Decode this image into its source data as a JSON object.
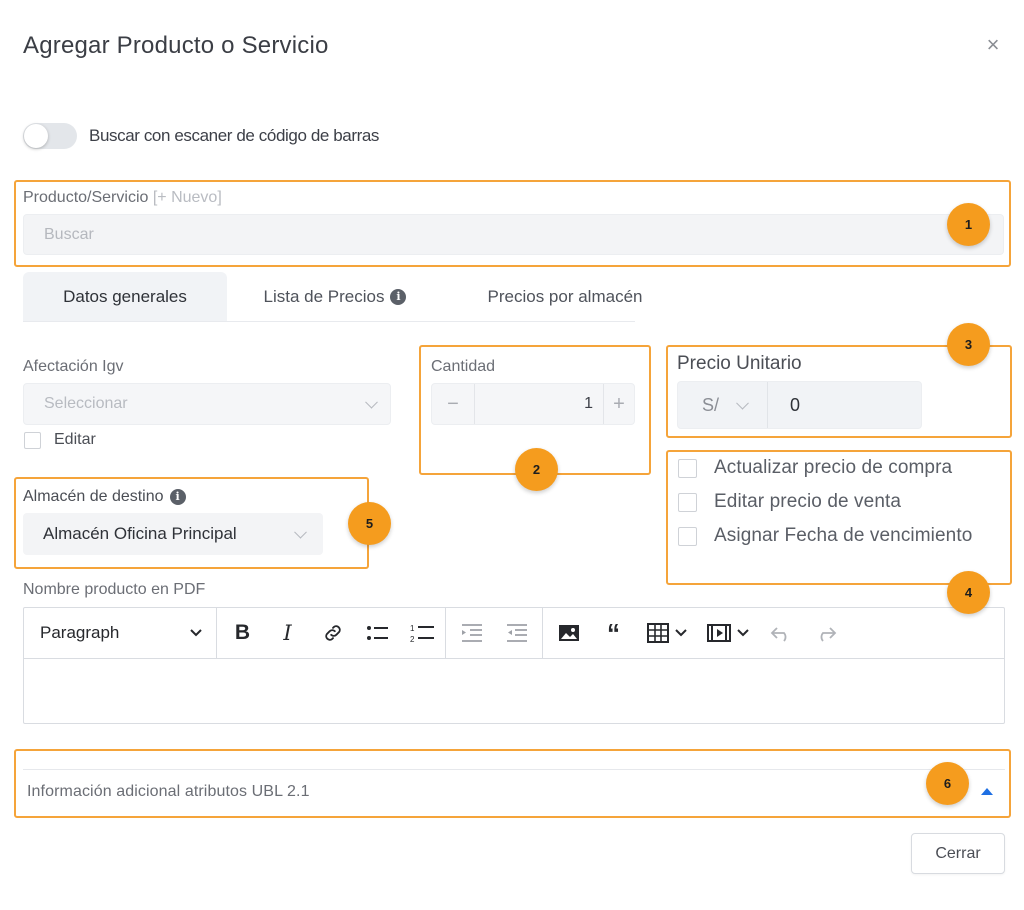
{
  "modal": {
    "title": "Agregar Producto o Servicio",
    "close_glyph": "×"
  },
  "scanner": {
    "label": "Buscar con escaner de código de barras",
    "enabled": false
  },
  "product": {
    "label": "Producto/Servicio",
    "new_link": "[+ Nuevo]",
    "placeholder": "Buscar"
  },
  "tabs": [
    {
      "label": "Datos generales",
      "active": true
    },
    {
      "label": "Lista de Precios",
      "icon": "info-icon"
    },
    {
      "label": "Precios por almacén"
    }
  ],
  "igv": {
    "label": "Afectación Igv",
    "placeholder": "Seleccionar",
    "edit_label": "Editar"
  },
  "quantity": {
    "label": "Cantidad",
    "value": "1",
    "minus": "−",
    "plus": "+"
  },
  "unit_price": {
    "label": "Precio Unitario",
    "currency": "S/",
    "value": "0"
  },
  "price_options": [
    "Actualizar precio de compra",
    "Editar precio de venta",
    "Asignar Fecha de vencimiento"
  ],
  "warehouse": {
    "label": "Almacén de destino",
    "value": "Almacén Oficina Principal",
    "icon": "info-icon"
  },
  "pdf_name": {
    "label": "Nombre producto en PDF",
    "format": "Paragraph"
  },
  "toolbar_icons": [
    "bold-icon",
    "italic-icon",
    "link-icon",
    "bullet-list-icon",
    "numbered-list-icon",
    "outdent-icon",
    "indent-icon",
    "image-icon",
    "quote-icon",
    "table-icon",
    "media-icon",
    "undo-icon",
    "redo-icon"
  ],
  "ubl": {
    "label": "Información adicional atributos UBL 2.1"
  },
  "footer": {
    "close_label": "Cerrar"
  },
  "annotations": [
    "1",
    "2",
    "3",
    "4",
    "5",
    "6"
  ],
  "colors": {
    "highlight": "#f5a43a",
    "badge": "#f59c1e",
    "accent": "#1e6fe3"
  }
}
